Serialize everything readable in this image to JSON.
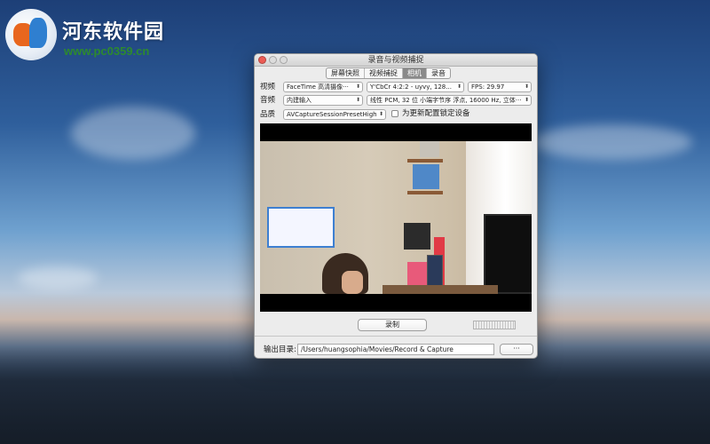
{
  "watermark": {
    "title": "河东软件园",
    "url": "www.pc0359.cn"
  },
  "window": {
    "title": "录音与视频捕捉"
  },
  "tabs": [
    {
      "label": "屏幕快照",
      "active": false
    },
    {
      "label": "视频捕捉",
      "active": false
    },
    {
      "label": "相机",
      "active": true
    },
    {
      "label": "录音",
      "active": false
    }
  ],
  "video": {
    "label": "视频",
    "device": "FaceTime 高清摄像···",
    "format": "Y'CbCr 4:2:2 - uyvy, 128...",
    "fps": "FPS: 29.97"
  },
  "audio": {
    "label": "音频",
    "device": "内建输入",
    "format": "线性 PCM, 32 位 小端字节序 浮点, 16000 Hz, 立体···"
  },
  "quality": {
    "label": "品质",
    "preset": "AVCaptureSessionPresetHigh",
    "lock_label": "为更新配置锁定设备"
  },
  "record_button": "录制",
  "output": {
    "label": "输出目录:",
    "path": "/Users/huangsophia/Movies/Record & Capture",
    "browse_label": "···"
  },
  "icons": {
    "popup_arrow": "⬍"
  }
}
